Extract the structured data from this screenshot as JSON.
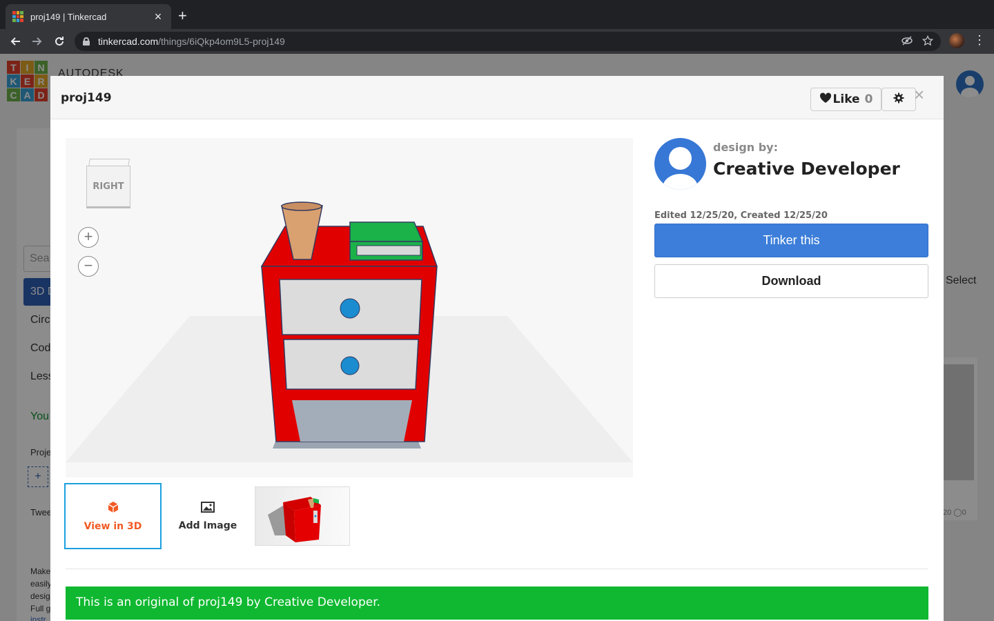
{
  "browser": {
    "tab_title": "proj149 | Tinkercad",
    "close_tab": "×",
    "new_tab": "+",
    "url_host": "tinkercad.com",
    "url_path": "/things/6iQkp4om9L5-proj149"
  },
  "background_page": {
    "logo_letters": [
      "T",
      "I",
      "N",
      "K",
      "E",
      "R",
      "C",
      "A",
      "D"
    ],
    "logo_colors": [
      "#e2412c",
      "#e2a727",
      "#6cb14a",
      "#3aa0d6",
      "#e2412c",
      "#e2a727",
      "#6cb14a",
      "#3aa0d6",
      "#e2412c"
    ],
    "autodesk": "AUTODESK",
    "search_placeholder": "Sea",
    "nav_items": [
      "3D D",
      "Circ",
      "Cod",
      "Less"
    ],
    "you_text": "You",
    "projects_text": "Proje",
    "tweets_text": "Twee",
    "add_label": "+",
    "select_label": "Select",
    "body_lines": [
      "Make",
      "easily",
      "desig",
      "Full g",
      "instr"
    ],
    "card_stats": "20 ◯0"
  },
  "modal": {
    "title": "proj149",
    "like_label": "Like",
    "like_count": "0",
    "close": "×",
    "viewer": {
      "viewcube_label": "RIGHT",
      "zoom_in": "+",
      "zoom_out": "−"
    },
    "thumbnails": {
      "view_3d_label": "View in 3D",
      "add_image_label": "Add Image"
    },
    "author": {
      "design_by": "design by:",
      "name": "Creative Developer"
    },
    "dates": "Edited 12/25/20, Created 12/25/20",
    "tinker_button": "Tinker this",
    "download_button": "Download",
    "banner": "This is an original of proj149 by Creative Developer."
  },
  "colors": {
    "accent_blue": "#3c7ed9",
    "banner_green": "#0fb830",
    "orange": "#f15a24",
    "thumb_border": "#1aa0e0"
  },
  "icons": [
    "tinkercad-favicon",
    "back-arrow-icon",
    "forward-arrow-icon",
    "reload-icon",
    "lock-icon",
    "eye-off-icon",
    "star-icon",
    "menu-dots-icon",
    "heart-icon",
    "gear-icon",
    "close-icon",
    "cube-icon",
    "image-icon"
  ]
}
